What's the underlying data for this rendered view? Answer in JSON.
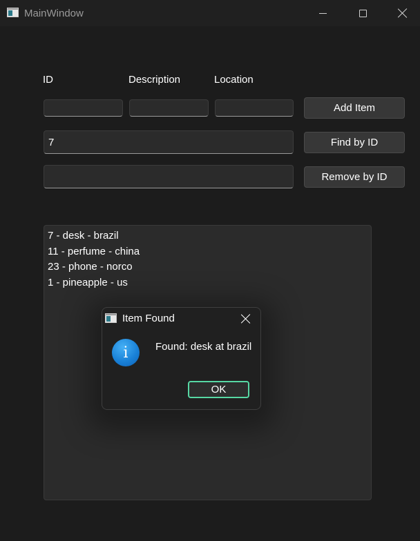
{
  "window": {
    "title": "MainWindow"
  },
  "labels": {
    "id": "ID",
    "description": "Description",
    "location": "Location"
  },
  "inputs": {
    "id_value": "",
    "description_value": "",
    "location_value": "",
    "find_id_value": "7",
    "remove_id_value": ""
  },
  "buttons": {
    "add": "Add Item",
    "find": "Find by ID",
    "remove": "Remove by ID"
  },
  "list": {
    "items": [
      "7 - desk - brazil",
      "11 - perfume - china",
      "23 - phone - norco",
      "1 - pineapple - us"
    ]
  },
  "dialog": {
    "title": "Item Found",
    "message": "Found: desk at brazil",
    "icon_glyph": "i",
    "ok_label": "OK"
  },
  "colors": {
    "background": "#1c1c1c",
    "titlebar": "#202020",
    "field": "#2b2b2b",
    "button": "#373737",
    "accent": "#57d8a4",
    "info_blue": "#1a82d8"
  }
}
